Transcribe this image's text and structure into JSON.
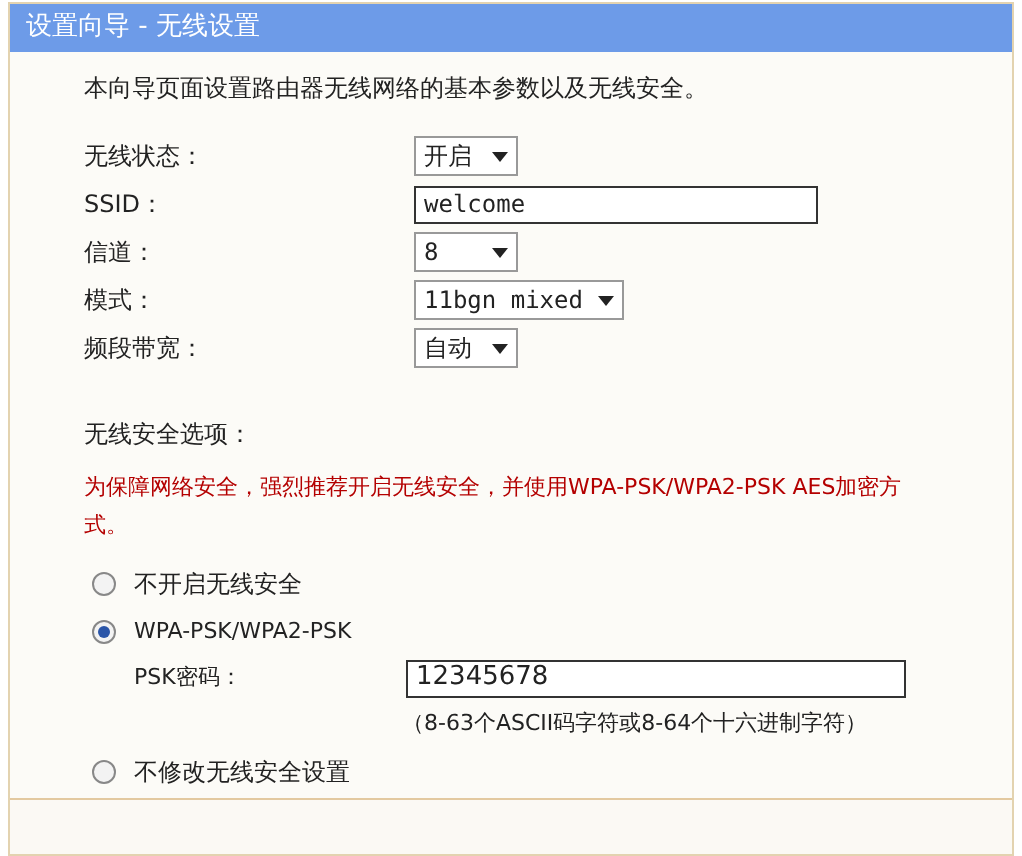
{
  "window": {
    "title": "设置向导 - 无线设置"
  },
  "intro": "本向导页面设置路由器无线网络的基本参数以及无线安全。",
  "fields": [
    {
      "kind": "select",
      "label": "无线状态：",
      "value": "开启"
    },
    {
      "kind": "text",
      "label": "SSID：",
      "value": "welcome"
    },
    {
      "kind": "select",
      "label": "信道：",
      "value": "8"
    },
    {
      "kind": "select",
      "label": "模式：",
      "value": "11bgn mixed"
    },
    {
      "kind": "select",
      "label": "频段带宽：",
      "value": "自动"
    }
  ],
  "security": {
    "title": "无线安全选项：",
    "warning": "为保障网络安全，强烈推荐开启无线安全，并使用WPA-PSK/WPA2-PSK AES加密方式。",
    "options": [
      {
        "label": "不开启无线安全",
        "selected": false
      },
      {
        "label": "WPA-PSK/WPA2-PSK",
        "selected": true,
        "psk": {
          "label": "PSK密码：",
          "value": "12345678",
          "hint": "（8-63个ASCII码字符或8-64个十六进制字符）"
        }
      },
      {
        "label": "不修改无线安全设置",
        "selected": false
      }
    ]
  }
}
